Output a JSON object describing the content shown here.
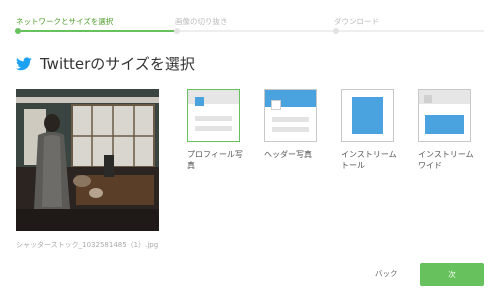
{
  "steps": [
    {
      "label": "ネットワークとサイズを選択",
      "active": true
    },
    {
      "label": "画像の切り抜き",
      "active": false
    },
    {
      "label": "ダウンロード",
      "active": false
    }
  ],
  "title": "Twitterのサイズを選択",
  "image": {
    "caption": "シャッターストック_1032581485（1）.jpg"
  },
  "options": [
    {
      "label_line1": "プロフィール写",
      "label_line2": "真",
      "selected": true
    },
    {
      "label_line1": "ヘッダー写真",
      "label_line2": "",
      "selected": false
    },
    {
      "label_line1": "インストリーム",
      "label_line2": "トール",
      "selected": false
    },
    {
      "label_line1": "インストリーム",
      "label_line2": "ワイド",
      "selected": false
    }
  ],
  "buttons": {
    "back": "バック",
    "next": "次"
  },
  "colors": {
    "accent": "#67c25d",
    "twitter": "#1da1f2",
    "option_blue": "#4aa3df"
  },
  "icons": {
    "title": "twitter-bird-icon"
  }
}
